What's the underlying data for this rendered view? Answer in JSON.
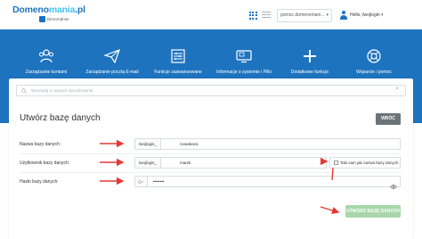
{
  "header": {
    "logo": {
      "part1": "Domeno",
      "part2": "mania",
      "part3": ".pl",
      "sub": "DirectAdmin"
    },
    "domain_select": "pomoc.domenomani...",
    "greeting": "Hello, twojlogin",
    "caret": "▾",
    "icons": [
      "grid-view-icon",
      "list-view-icon",
      "user-icon"
    ]
  },
  "nav": {
    "items": [
      {
        "label": "Zarządzanie kontami",
        "icon": "accounts-icon"
      },
      {
        "label": "Zarządzanie pocztą E-mail",
        "icon": "paper-plane-icon"
      },
      {
        "label": "Funkcje zaawansowane",
        "icon": "advanced-settings-icon"
      },
      {
        "label": "Informacje o systemie i Pliki",
        "icon": "system-files-icon"
      },
      {
        "label": "Dodatkowe funkcje",
        "icon": "plus-icon"
      },
      {
        "label": "Wsparcie i pomoc",
        "icon": "lifebuoy-icon"
      }
    ]
  },
  "search": {
    "placeholder": "Wyszukaj w opcjach wyszukiwania",
    "clear": "×"
  },
  "form": {
    "title": "Utwórz bazę danych",
    "back_label": "WRÓĆ",
    "db_name": {
      "label": "Nazwa bazy danych:",
      "prefix": "twojlogin_",
      "value": "nowabaza"
    },
    "db_user": {
      "label": "Użytkownik bazy danych:",
      "prefix": "twojlogin_",
      "value": "marek",
      "same_as_db_label": "Taki sam jak nazwa bazy danych"
    },
    "db_password": {
      "label": "Hasło bazy danych:",
      "value": "••••••••"
    },
    "create_label": "UTWÓRZ BAZĘ DANYCH"
  },
  "colors": {
    "primary": "#1e73be",
    "accent": "#44c2f0",
    "annotation": "#e53935",
    "create_button": "#a8d6aa",
    "back_button": "#6d7479"
  }
}
